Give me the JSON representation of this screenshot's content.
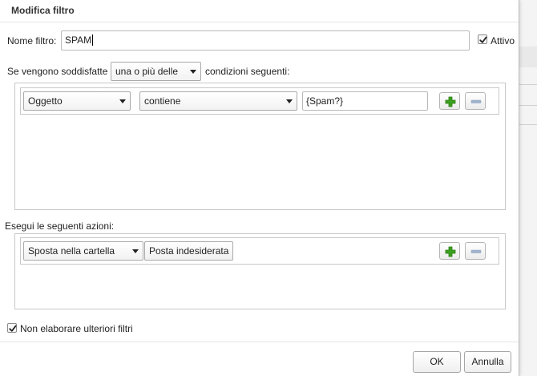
{
  "dialog": {
    "title": "Modifica filtro"
  },
  "filter": {
    "name_label": "Nome filtro:",
    "name_value": "SPAM",
    "active_label": "Attivo",
    "active_checked": true
  },
  "conditions": {
    "prefix_label": "Se vengono soddisfatte",
    "match_mode": "una o più delle",
    "suffix_label": "condizioni seguenti:",
    "rows": [
      {
        "field": "Oggetto",
        "operator": "contiene",
        "value": "{Spam?}"
      }
    ]
  },
  "actions": {
    "label": "Esegui le seguenti azioni:",
    "rows": [
      {
        "action": "Sposta nella cartella",
        "target_folder": "Posta indesiderata"
      }
    ]
  },
  "options": {
    "stop_label": "Non elaborare ulteriori filtri",
    "stop_checked": true
  },
  "footer": {
    "ok_label": "OK",
    "cancel_label": "Annulla"
  },
  "icons": {
    "add": "plus-icon",
    "remove": "minus-icon",
    "dropdown": "chevron-down-icon",
    "check": "checkmark-icon"
  },
  "colors": {
    "add_icon": "#3aa01e",
    "remove_icon": "#9fb3cc"
  }
}
